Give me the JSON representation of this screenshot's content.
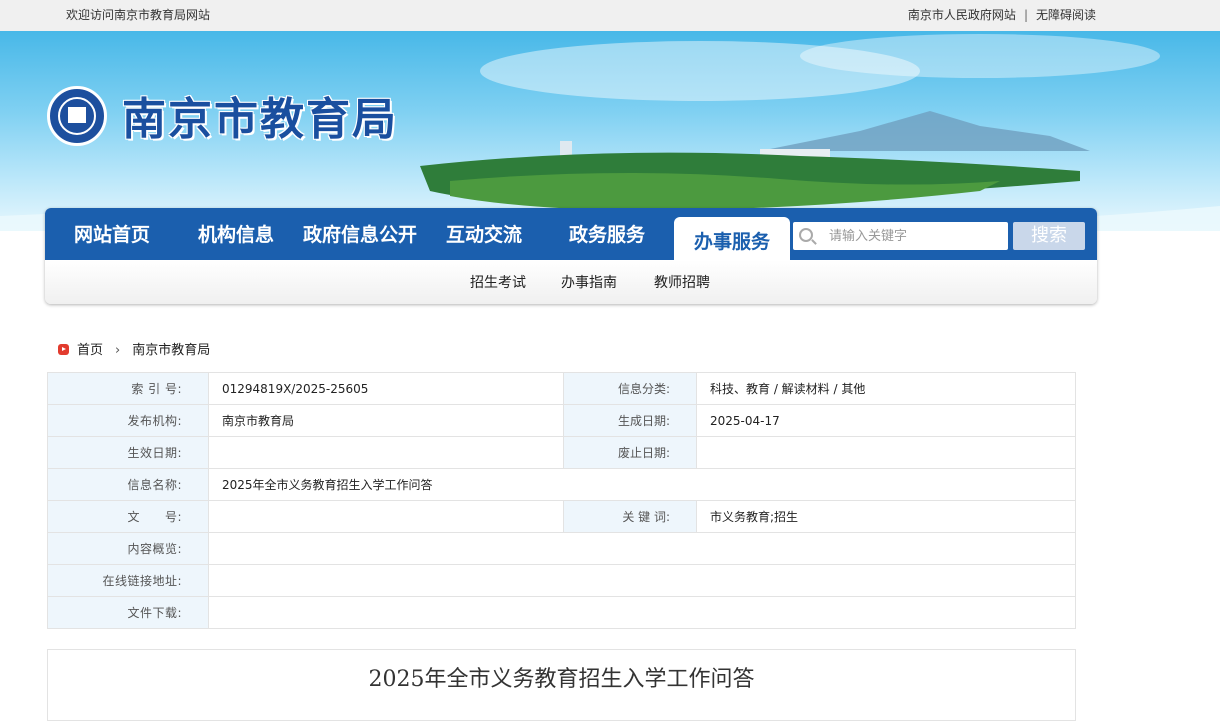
{
  "topbar": {
    "welcome": "欢迎访问南京市教育局网站",
    "gov_link": "南京市人民政府网站",
    "separator": "|",
    "accessibility": "无障碍阅读"
  },
  "header": {
    "site_title": "南京市教育局"
  },
  "nav": {
    "items": [
      "网站首页",
      "机构信息",
      "政府信息公开",
      "互动交流",
      "政务服务",
      "办事服务"
    ],
    "active": "办事服务",
    "search_placeholder": "请输入关键字",
    "search_button": "搜索"
  },
  "subnav": [
    "招生考试",
    "办事指南",
    "教师招聘"
  ],
  "breadcrumb": {
    "home": "首页",
    "current": "南京市教育局"
  },
  "meta": {
    "index_label": "索 引 号:",
    "index_value": "01294819X/2025-25605",
    "category_label": "信息分类:",
    "category_value": "科技、教育 / 解读材料 / 其他",
    "publisher_label": "发布机构:",
    "publisher_value": "南京市教育局",
    "created_label": "生成日期:",
    "created_value": "2025-04-17",
    "effective_label": "生效日期:",
    "effective_value": "",
    "abolish_label": "废止日期:",
    "abolish_value": "",
    "name_label": "信息名称:",
    "name_value": "2025年全市义务教育招生入学工作问答",
    "docno_label": "文　　号:",
    "docno_value": "",
    "keywords_label": "关 键 词:",
    "keywords_value": "市义务教育;招生",
    "summary_label": "内容概览:",
    "summary_value": "",
    "link_label": "在线链接地址:",
    "link_value": "",
    "download_label": "文件下载:",
    "download_value": ""
  },
  "article": {
    "title": "2025年全市义务教育招生入学工作问答"
  },
  "colors": {
    "nav_blue": "#1b5fae",
    "label_bg": "#eef6fc"
  }
}
